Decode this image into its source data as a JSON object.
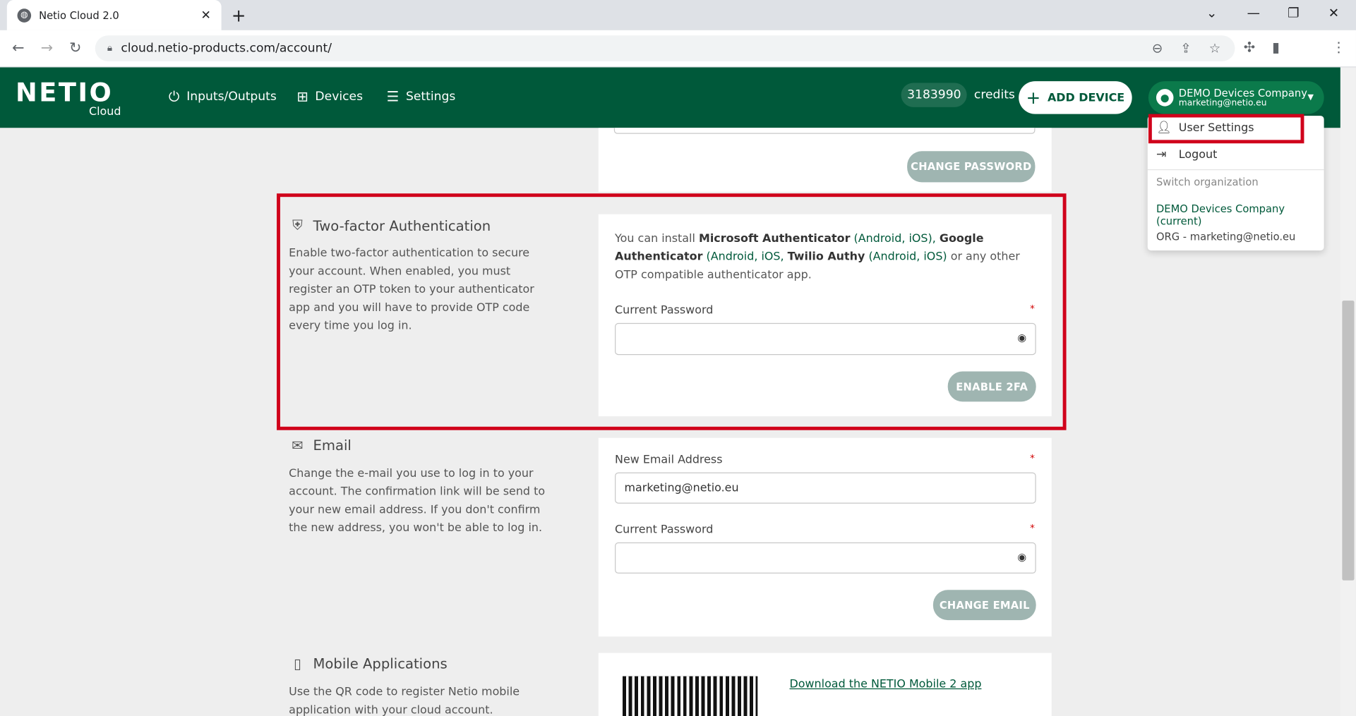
{
  "browser": {
    "tab_title": "Netio Cloud 2.0",
    "url": "cloud.netio-products.com/account/"
  },
  "header": {
    "logo_text": "NETIO",
    "logo_sub": "Cloud",
    "nav": [
      {
        "label": "Inputs/Outputs",
        "icon": "power-icon"
      },
      {
        "label": "Devices",
        "icon": "network-icon"
      },
      {
        "label": "Settings",
        "icon": "sliders-icon"
      }
    ],
    "credits_value": "3183990",
    "credits_label": "credits",
    "add_device": "ADD DEVICE",
    "user_name": "DEMO Devices Company",
    "user_email": "marketing@netio.eu"
  },
  "dropdown": {
    "user_settings": "User Settings",
    "logout": "Logout",
    "switch_org": "Switch organization",
    "orgs": [
      "DEMO Devices Company (current)",
      "ORG - marketing@netio.eu"
    ]
  },
  "password_section": {
    "change_button": "CHANGE PASSWORD"
  },
  "twofa": {
    "title": "Two-factor Authentication",
    "description": "Enable two-factor authentication to secure your account. When enabled, you must register an OTP token to your authenticator app and you will have to provide OTP code every time you log in.",
    "info_prefix": "You can install ",
    "ms_auth": "Microsoft Authenticator",
    "ms_links": "(Android, iOS),",
    "google_auth": "Google Authenticator",
    "google_links": "(Android, iOS,",
    "twilio": "Twilio Authy",
    "twilio_links": "(Android, iOS)",
    "info_suffix": " or any other OTP compatible authenticator app.",
    "password_label": "Current Password",
    "required_mark": "*",
    "button": "ENABLE 2FA"
  },
  "email": {
    "title": "Email",
    "description": "Change the e-mail you use to log in to your account. The confirmation link will be send to your new email address. If you don't confirm the new address, you won't be able to log in.",
    "new_label": "New Email Address",
    "new_value": "marketing@netio.eu",
    "password_label": "Current Password",
    "button": "CHANGE EMAIL"
  },
  "mobile": {
    "title": "Mobile Applications",
    "description": "Use the QR code to register Netio mobile application with your cloud account.",
    "link": "Download the NETIO Mobile 2 app"
  },
  "colors": {
    "brand": "#00593a",
    "highlight": "#d0021b",
    "disabled_button": "#9fb5b1"
  }
}
